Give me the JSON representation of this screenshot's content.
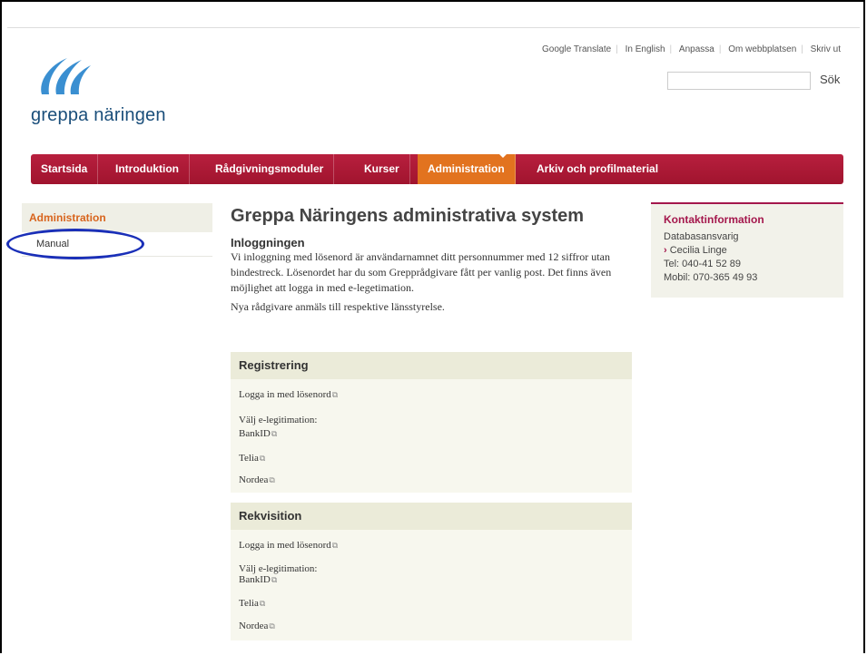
{
  "utility_links": [
    "Google Translate",
    "In English",
    "Anpassa",
    "Om webbplatsen",
    "Skriv ut"
  ],
  "search": {
    "button": "Sök"
  },
  "logo": {
    "text": "greppa näringen"
  },
  "nav": {
    "items": [
      "Startsida",
      "Introduktion",
      "Rådgivningsmoduler",
      "Kurser",
      "Administration",
      "Arkiv och profilmaterial"
    ],
    "active": "Administration"
  },
  "sidebar": {
    "heading": "Administration",
    "items": [
      "Manual"
    ]
  },
  "main": {
    "title": "Greppa Näringens administrativa system",
    "subheading": "Inloggningen",
    "paragraph": "Vi inloggning med lösenord är användarnamnet ditt personnummer med 12 siffror utan bindestreck. Lösenordet har du som Grepprådgivare fått per vanlig post. Det finns även möjlighet att logga in med e-legetimation.",
    "paragraph2": "Nya rådgivare anmäls till respektive länsstyrelse."
  },
  "registrering": {
    "heading": "Registrering",
    "login": "Logga in med lösenord",
    "choose": "Välj e-legitimation:",
    "options": [
      "BankID",
      "Telia",
      "Nordea"
    ]
  },
  "rekvisition": {
    "heading": "Rekvisition",
    "login": "Logga in med lösenord",
    "choose": "Välj e-legitimation:",
    "options": [
      "BankID",
      "Telia",
      "Nordea"
    ]
  },
  "contact": {
    "heading": "Kontaktinformation",
    "role": "Databasansvarig",
    "name": "Cecilia Linge",
    "tel": "Tel: 040-41 52 89",
    "mobil": "Mobil: 070-365 49 93"
  },
  "colors": {
    "nav": "#b81f3e",
    "active": "#e2731f",
    "accent": "#a4174c",
    "logo": "#1a4e7a"
  },
  "icons": {
    "external": "external-link-icon",
    "bullet": "chevron-right-icon"
  }
}
